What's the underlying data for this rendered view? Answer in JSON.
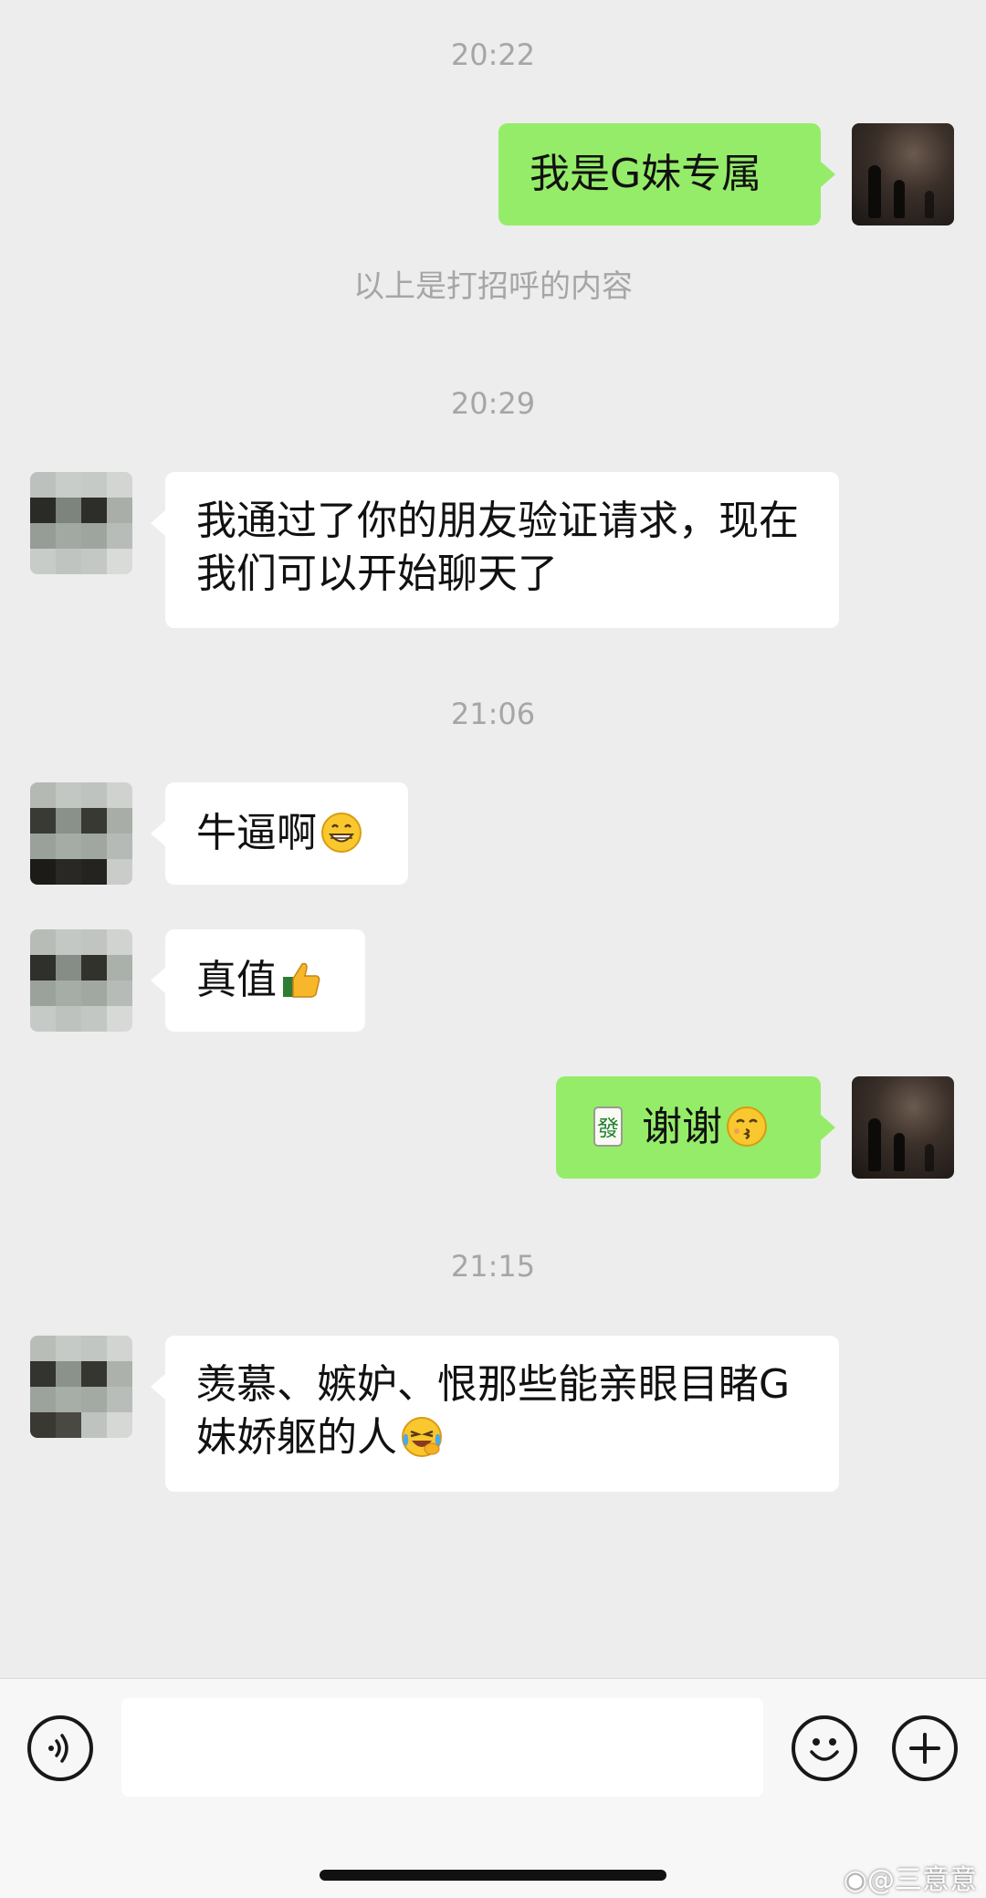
{
  "chat": {
    "timestamps": [
      "20:22",
      "20:29",
      "21:06",
      "21:15"
    ],
    "system_note": "以上是打招呼的内容",
    "messages": [
      {
        "sender": "me",
        "text": "我是G妹专属"
      },
      {
        "sender": "contact",
        "text": "我通过了你的朋友验证请求，现在我们可以开始聊天了"
      },
      {
        "sender": "contact",
        "text": "牛逼啊",
        "emoji": "grinning-face-icon"
      },
      {
        "sender": "contact",
        "text": "真值",
        "emoji": "thumbs-up-icon"
      },
      {
        "sender": "me",
        "prefix_emoji": "mahjong-tile-icon",
        "text": "谢谢",
        "emoji": "kissing-face-icon"
      },
      {
        "sender": "contact",
        "text": "羡慕、嫉妒、恨那些能亲眼目睹G妹娇躯的人",
        "emoji": "laughing-crying-face-icon"
      }
    ]
  },
  "input_bar": {
    "text_value": "",
    "voice_icon": "voice-icon",
    "emoji_icon": "smiley-icon",
    "more_icon": "plus-icon"
  },
  "watermark": "@三意意",
  "colors": {
    "background": "#ededed",
    "bubble_out": "#95ec69",
    "bubble_in": "#ffffff",
    "timestamp_text": "#a6a6a6"
  }
}
